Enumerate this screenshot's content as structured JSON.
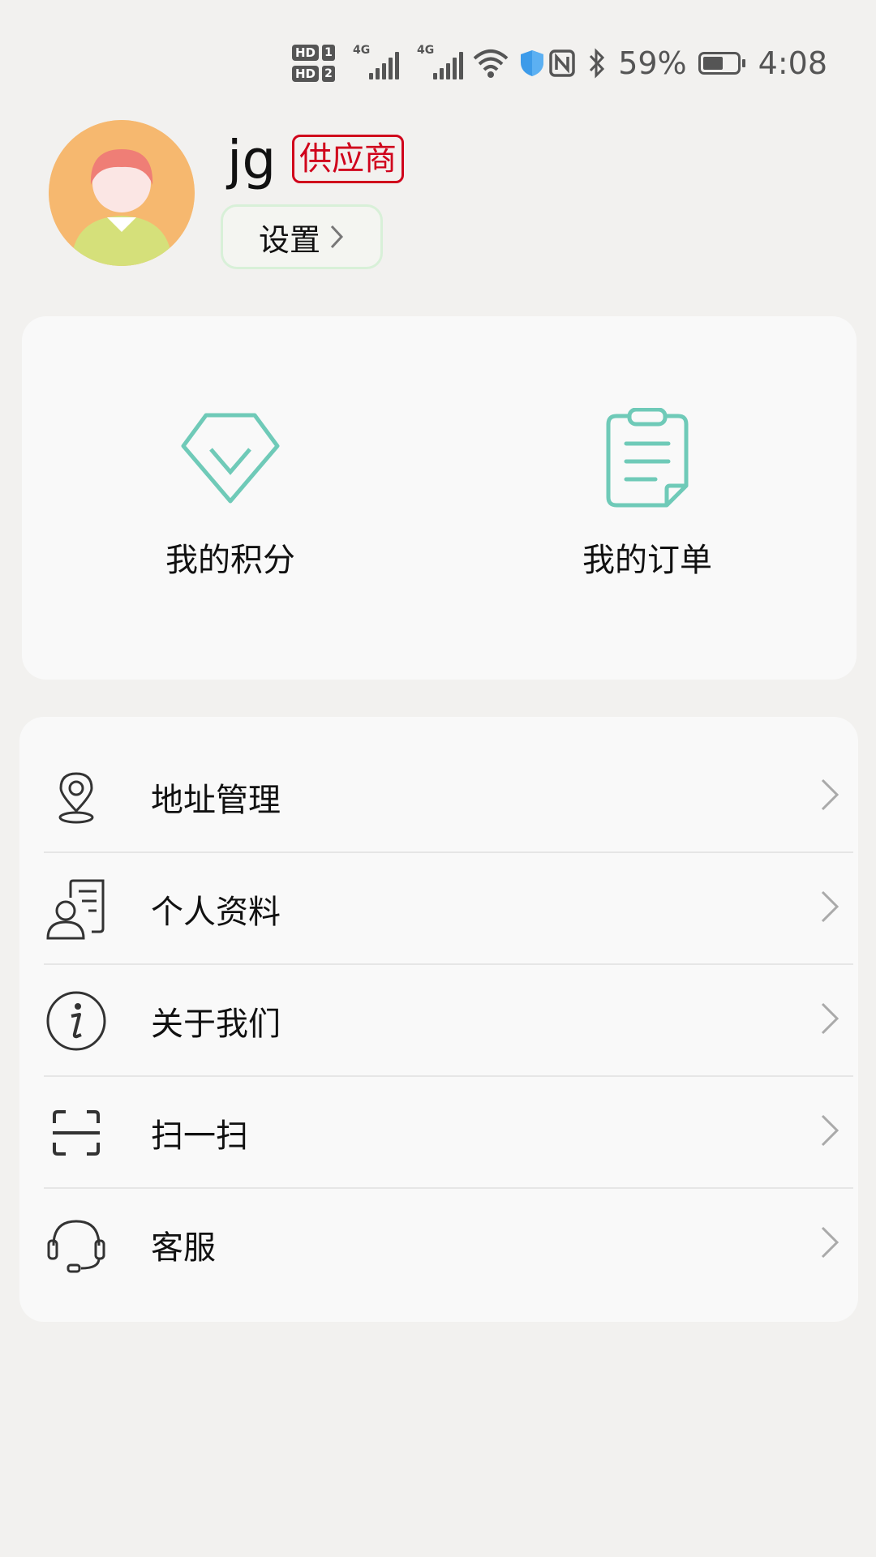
{
  "status_bar": {
    "hd1": "HD",
    "hd1_num": "1",
    "hd2": "HD",
    "hd2_num": "2",
    "net1": "4G",
    "net2": "4G",
    "battery_text": "59%",
    "battery_level": 0.59,
    "time": "4:08",
    "icons": [
      "signal-icon",
      "wifi-icon",
      "shield-icon",
      "nfc-icon",
      "bluetooth-icon",
      "battery-icon"
    ]
  },
  "profile": {
    "username": "jg",
    "role_badge": "供应商",
    "settings_label": "设置"
  },
  "quick_actions": [
    {
      "label": "我的积分",
      "icon": "diamond-icon"
    },
    {
      "label": "我的订单",
      "icon": "clipboard-icon"
    }
  ],
  "menu": [
    {
      "label": "地址管理",
      "icon": "location-pin-icon"
    },
    {
      "label": "个人资料",
      "icon": "profile-card-icon"
    },
    {
      "label": "关于我们",
      "icon": "info-icon"
    },
    {
      "label": "扫一扫",
      "icon": "scan-icon"
    },
    {
      "label": "客服",
      "icon": "headset-icon"
    }
  ],
  "colors": {
    "accent": "#6fcab8",
    "badge": "#d0021b",
    "background": "#f2f1ef",
    "card": "#f9f9f9"
  }
}
